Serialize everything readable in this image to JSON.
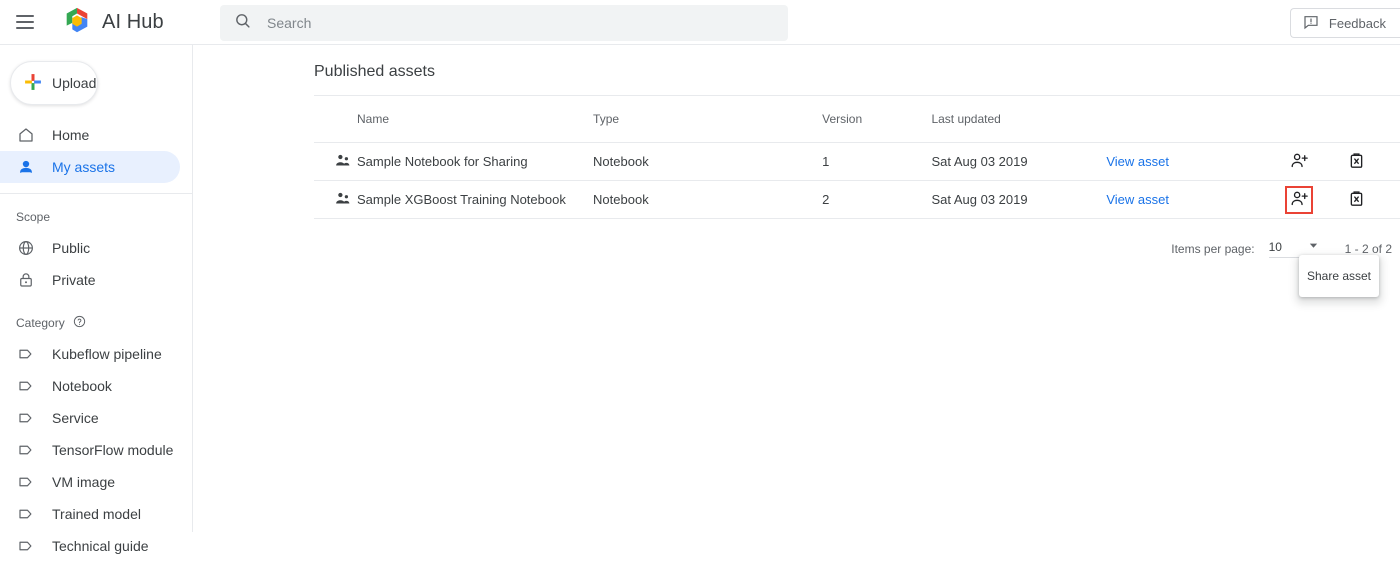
{
  "topbar": {
    "menu_icon": "hamburger-icon",
    "logo_icon": "ai-hub-cube-logo",
    "title": "AI Hub",
    "search": {
      "icon": "search-icon",
      "placeholder": "Search",
      "value": ""
    },
    "feedback": {
      "icon": "feedback-comment-icon",
      "label": "Feedback"
    }
  },
  "sidebar": {
    "upload": {
      "icon": "plus-icon",
      "label": "Upload"
    },
    "primary": [
      {
        "icon": "home-icon",
        "label": "Home",
        "active": false
      },
      {
        "icon": "person-icon",
        "label": "My assets",
        "active": true
      }
    ],
    "scope_label": "Scope",
    "scope": [
      {
        "icon": "globe-icon",
        "label": "Public"
      },
      {
        "icon": "lock-icon",
        "label": "Private"
      }
    ],
    "category_label": "Category",
    "category_help_icon": "help-circle-icon",
    "categories": [
      {
        "icon": "tag-icon",
        "label": "Kubeflow pipeline"
      },
      {
        "icon": "tag-icon",
        "label": "Notebook"
      },
      {
        "icon": "tag-icon",
        "label": "Service"
      },
      {
        "icon": "tag-icon",
        "label": "TensorFlow module"
      },
      {
        "icon": "tag-icon",
        "label": "VM image"
      },
      {
        "icon": "tag-icon",
        "label": "Trained model"
      },
      {
        "icon": "tag-icon",
        "label": "Technical guide"
      }
    ]
  },
  "main": {
    "page_title": "Published assets",
    "table": {
      "columns": [
        "Name",
        "Type",
        "Version",
        "Last updated",
        "",
        "",
        ""
      ],
      "rows": [
        {
          "icon": "shared-person-icon",
          "name": "Sample Notebook for Sharing",
          "type": "Notebook",
          "version": "1",
          "last_updated": "Sat Aug 03 2019",
          "view_label": "View asset",
          "share_icon": "person-add-icon",
          "delete_icon": "delete-trash-icon",
          "share_highlighted": false
        },
        {
          "icon": "shared-person-icon",
          "name": "Sample XGBoost Training Notebook",
          "type": "Notebook",
          "version": "2",
          "last_updated": "Sat Aug 03 2019",
          "view_label": "View asset",
          "share_icon": "person-add-icon",
          "delete_icon": "delete-trash-icon",
          "share_highlighted": true
        }
      ]
    },
    "paginator": {
      "items_per_page_label": "Items per page:",
      "items_per_page_value": "10",
      "dropdown_icon": "chevron-down-icon",
      "range_label": "1 - 2 of 2"
    },
    "tooltip": {
      "text": "Share asset"
    }
  },
  "colors": {
    "accent_blue": "#1a73e8",
    "selected_bg": "#e8f0fe",
    "highlight_red": "#ea4335",
    "border": "#e8eaed",
    "muted_text": "#5f6368",
    "text": "#3c4043",
    "search_bg": "#f1f3f4"
  }
}
